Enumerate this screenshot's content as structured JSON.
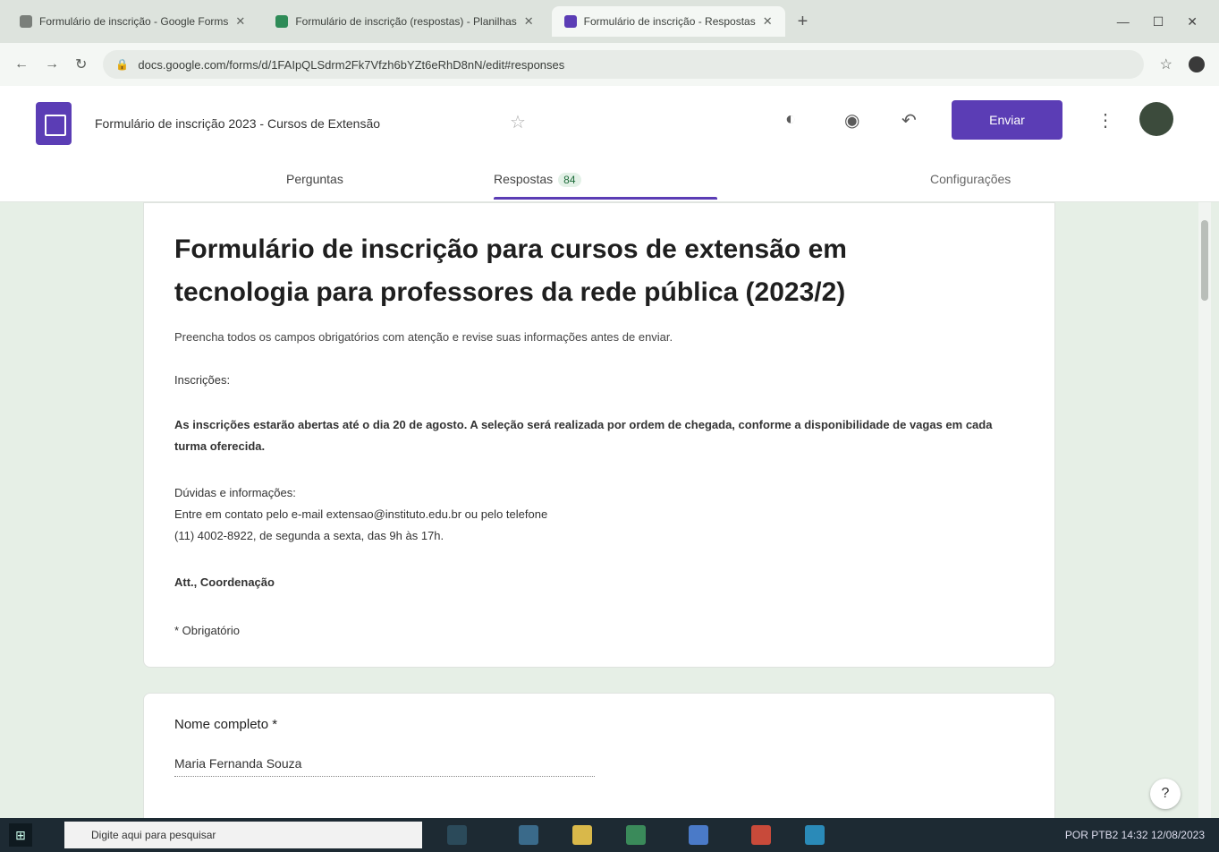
{
  "browser": {
    "tabs": [
      {
        "title": "Formulário de inscrição - Google Forms"
      },
      {
        "title": "Formulário de inscrição (respostas) - Planilhas"
      },
      {
        "title": "Formulário de inscrição - Respostas",
        "active": true
      }
    ],
    "url": "docs.google.com/forms/d/1FAIpQLSdrm2Fk7Vfzh6bYZt6eRhD8nN/edit#responses",
    "new_tab": "+"
  },
  "header": {
    "doc_title": "Formulário de inscrição 2023 - Cursos de Extensão",
    "send_label": "Enviar",
    "tabs": {
      "questions": "Perguntas",
      "responses": "Respostas",
      "response_count": "84",
      "settings": "Configurações"
    }
  },
  "form": {
    "title": "Formulário de inscrição para cursos de extensão em tecnologia para professores da rede pública (2023/2)",
    "description": "Preencha todos os campos obrigatórios com atenção e revise suas informações antes de enviar.",
    "lines": [
      "Inscrições:",
      "As inscrições estarão abertas até o dia 20 de agosto. A seleção será realizada por ordem de chegada, conforme a disponibilidade de vagas em cada turma oferecida.",
      "Dúvidas e informações:",
      "Entre em contato pelo e-mail extensao@instituto.edu.br ou pelo telefone",
      "(11) 4002-8922, de segunda a sexta, das 9h às 17h.",
      "Att., Coordenação",
      "* Obrigatório"
    ]
  },
  "question": {
    "title": "Nome completo *",
    "answer": "Maria Fernanda Souza"
  },
  "taskbar": {
    "search_placeholder": "Digite aqui para pesquisar",
    "tray": "POR PTB2  14:32  12/08/2023"
  }
}
